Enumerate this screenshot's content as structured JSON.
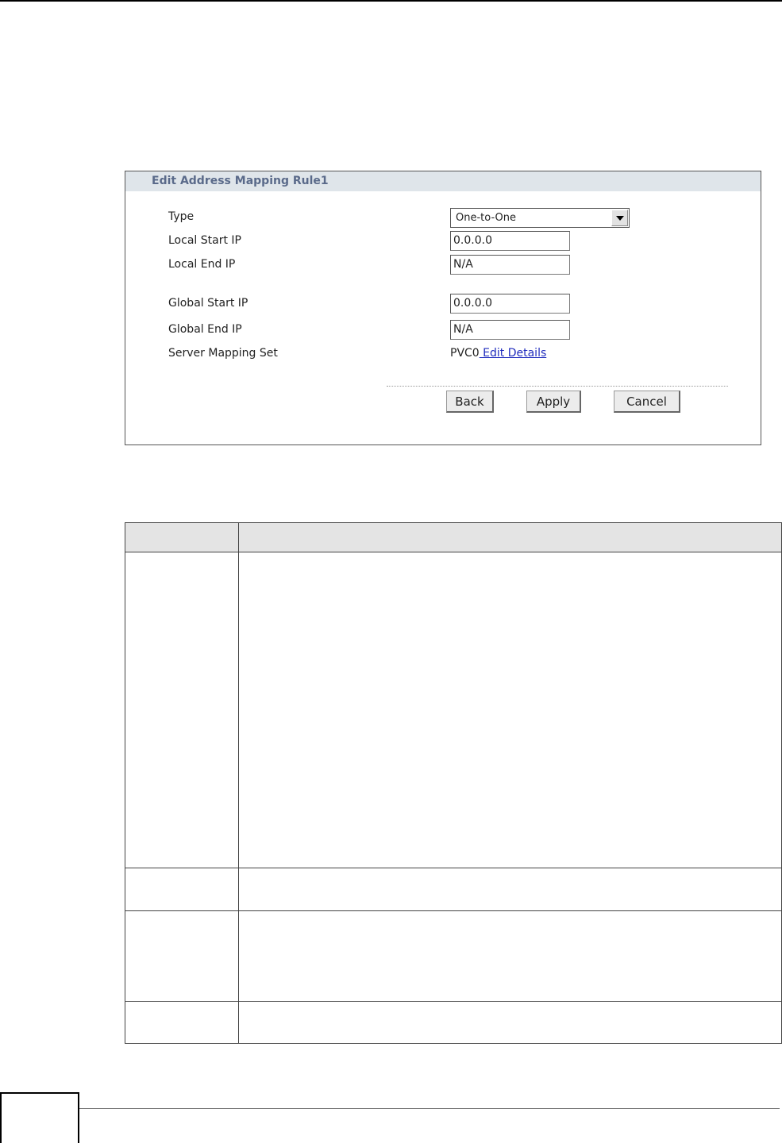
{
  "panel": {
    "title": "Edit Address Mapping Rule1",
    "fields": {
      "type_label": "Type",
      "type_value": "One-to-One",
      "local_start_label": "Local Start IP",
      "local_start_value": "0.0.0.0",
      "local_end_label": "Local End IP",
      "local_end_value": "N/A",
      "global_start_label": "Global Start IP",
      "global_start_value": "0.0.0.0",
      "global_end_label": "Global End IP",
      "global_end_value": "N/A",
      "server_set_label": "Server Mapping Set",
      "server_set_value": "PVC0",
      "server_set_link": " Edit Details"
    },
    "buttons": {
      "back": "Back",
      "apply": "Apply",
      "cancel": "Cancel"
    },
    "icons": {
      "dropdown": "chevron-down-icon"
    }
  },
  "table": {
    "header": [
      "",
      ""
    ],
    "rows": [
      [
        "",
        ""
      ],
      [
        "",
        ""
      ],
      [
        "",
        ""
      ],
      [
        "",
        ""
      ]
    ]
  },
  "colors": {
    "header_bg": "#dfe5ea",
    "header_text": "#5a6a8a",
    "link": "#1f2bbd",
    "table_header_bg": "#e4e4e4"
  }
}
